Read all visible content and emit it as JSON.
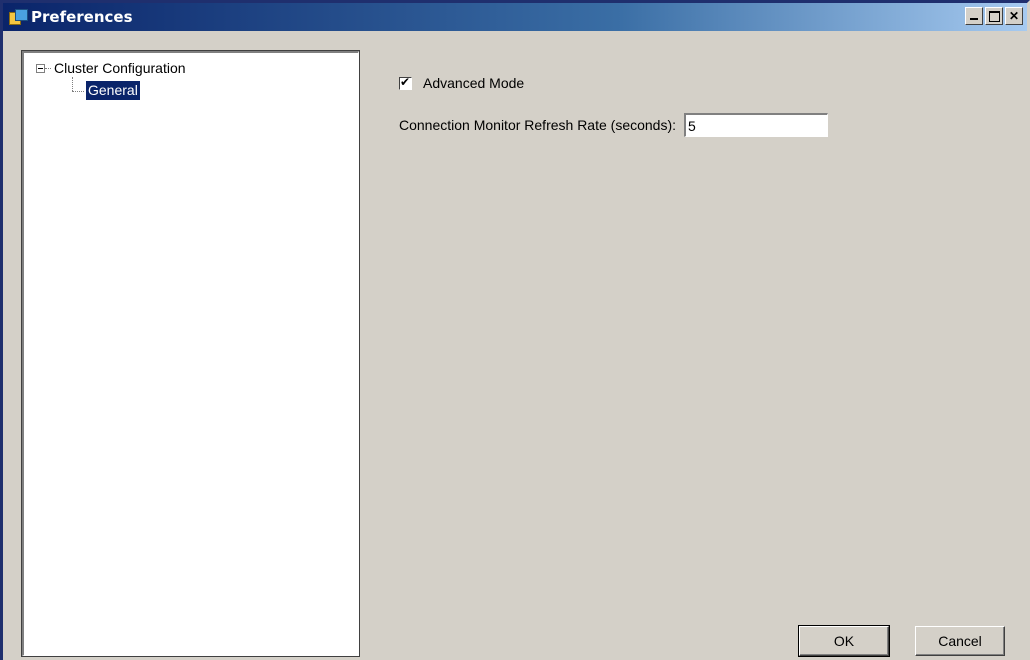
{
  "window": {
    "title": "Preferences",
    "controls": [
      "minimize",
      "maximize",
      "close"
    ]
  },
  "tree": {
    "root": {
      "label": "Cluster Configuration",
      "expanded": true
    },
    "children": [
      {
        "label": "General",
        "selected": true
      }
    ]
  },
  "general": {
    "advanced_mode": {
      "label": "Advanced Mode",
      "checked": true
    },
    "refresh_rate": {
      "label": "Connection Monitor Refresh Rate (seconds):",
      "value": "5"
    }
  },
  "buttons": {
    "ok": "OK",
    "cancel": "Cancel"
  },
  "colors": {
    "titlebar_start": "#0a246a",
    "titlebar_end": "#a6caf0",
    "selection": "#0a246a",
    "dialog_face": "#d4d0c8"
  }
}
